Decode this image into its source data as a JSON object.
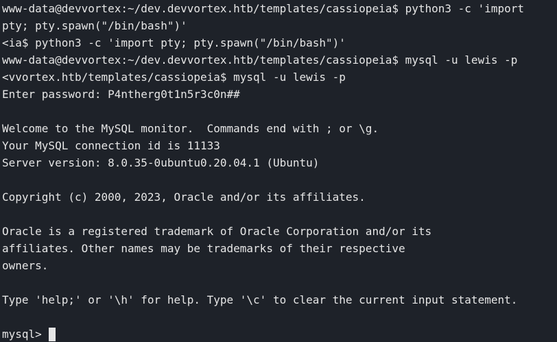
{
  "terminal": {
    "lines": [
      "www-data@devvortex:~/dev.devvortex.htb/templates/cassiopeia$ python3 -c 'import",
      "pty; pty.spawn(\"/bin/bash\")'",
      "<ia$ python3 -c 'import pty; pty.spawn(\"/bin/bash\")'",
      "www-data@devvortex:~/dev.devvortex.htb/templates/cassiopeia$ mysql -u lewis -p",
      "<vvortex.htb/templates/cassiopeia$ mysql -u lewis -p",
      "Enter password: P4ntherg0t1n5r3c0n##",
      "",
      "Welcome to the MySQL monitor.  Commands end with ; or \\g.",
      "Your MySQL connection id is 11133",
      "Server version: 8.0.35-0ubuntu0.20.04.1 (Ubuntu)",
      "",
      "Copyright (c) 2000, 2023, Oracle and/or its affiliates.",
      "",
      "Oracle is a registered trademark of Oracle Corporation and/or its",
      "affiliates. Other names may be trademarks of their respective",
      "owners.",
      "",
      "Type 'help;' or '\\h' for help. Type '\\c' to clear the current input statement.",
      ""
    ],
    "prompt": "mysql>"
  },
  "colors": {
    "background": "#1e2229",
    "foreground": "#e6e6e6"
  }
}
